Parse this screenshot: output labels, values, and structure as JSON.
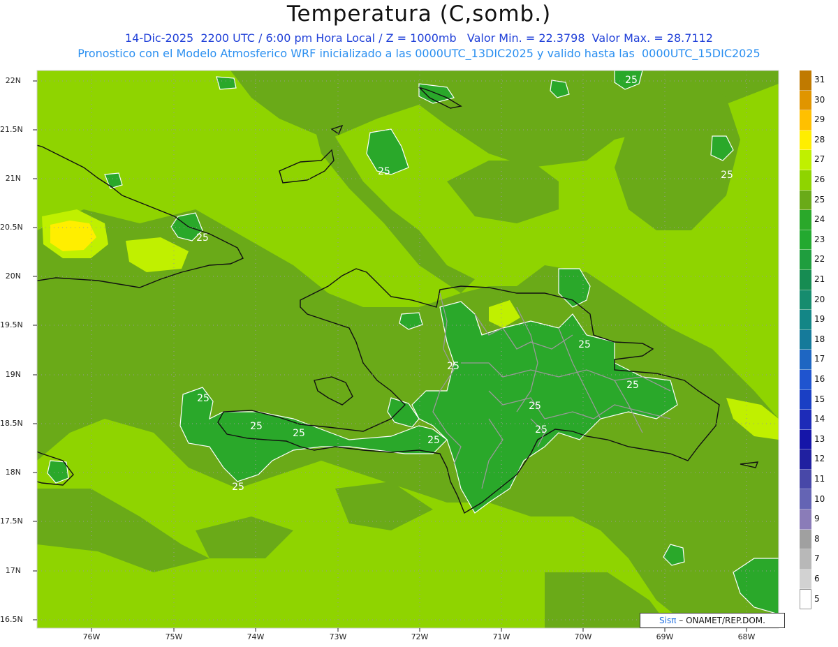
{
  "title": "Temperatura (C,somb.)",
  "subtitle1": "14-Dic-2025  2200 UTC / 6:00 pm Hora Local / Z = 1000mb   Valor Min. = 22.3798  Valor Max. = 28.7112",
  "subtitle2": "Pronostico con el Modelo Atmosferico WRF inicializado a las 0000UTC_13DIC2025 y valido hasta las  0000UTC_15DIC2025",
  "credit": {
    "prefix": "Sis",
    "pi": "π",
    "rest": "– ONAMET/REP.DOM."
  },
  "colors": {
    "subtitle1": "#1f3fd8",
    "subtitle2": "#2a8ff0",
    "credit_sis": "#1f6fe0"
  },
  "lat_labels": [
    "22N",
    "21.5N",
    "21N",
    "20.5N",
    "20N",
    "19.5N",
    "19N",
    "18.5N",
    "18N",
    "17.5N",
    "17N",
    "16.5N"
  ],
  "lon_labels": [
    "76W",
    "75W",
    "74W",
    "73W",
    "72W",
    "71W",
    "70W",
    "69W",
    "68W"
  ],
  "colorbar": {
    "labels": [
      "31",
      "30",
      "29",
      "28",
      "27",
      "26",
      "25",
      "24",
      "23",
      "22",
      "21",
      "20",
      "19",
      "18",
      "17",
      "16",
      "15",
      "14",
      "13",
      "12",
      "11",
      "10",
      "9",
      "8",
      "7",
      "6",
      "5"
    ],
    "colors": [
      "#c07a00",
      "#e09500",
      "#ffc000",
      "#ffee00",
      "#c0f000",
      "#8fd400",
      "#6aaa18",
      "#2aa82a",
      "#23a930",
      "#1f9e3e",
      "#168c52",
      "#168c6e",
      "#138686",
      "#157a9a",
      "#1e66c2",
      "#1f54cf",
      "#1a3fc4",
      "#1d2bb8",
      "#1515a8",
      "#2020a0",
      "#4848a8",
      "#6464b4",
      "#8a7cb8",
      "#a0a0a0",
      "#b8b8b8",
      "#d2d2d2",
      "#ffffff"
    ]
  },
  "contour_labels": [
    "25",
    "25",
    "25",
    "25",
    "25",
    "25",
    "25",
    "25",
    "25",
    "25",
    "25",
    "25",
    "25",
    "25",
    "25",
    "25",
    "25",
    "25"
  ]
}
